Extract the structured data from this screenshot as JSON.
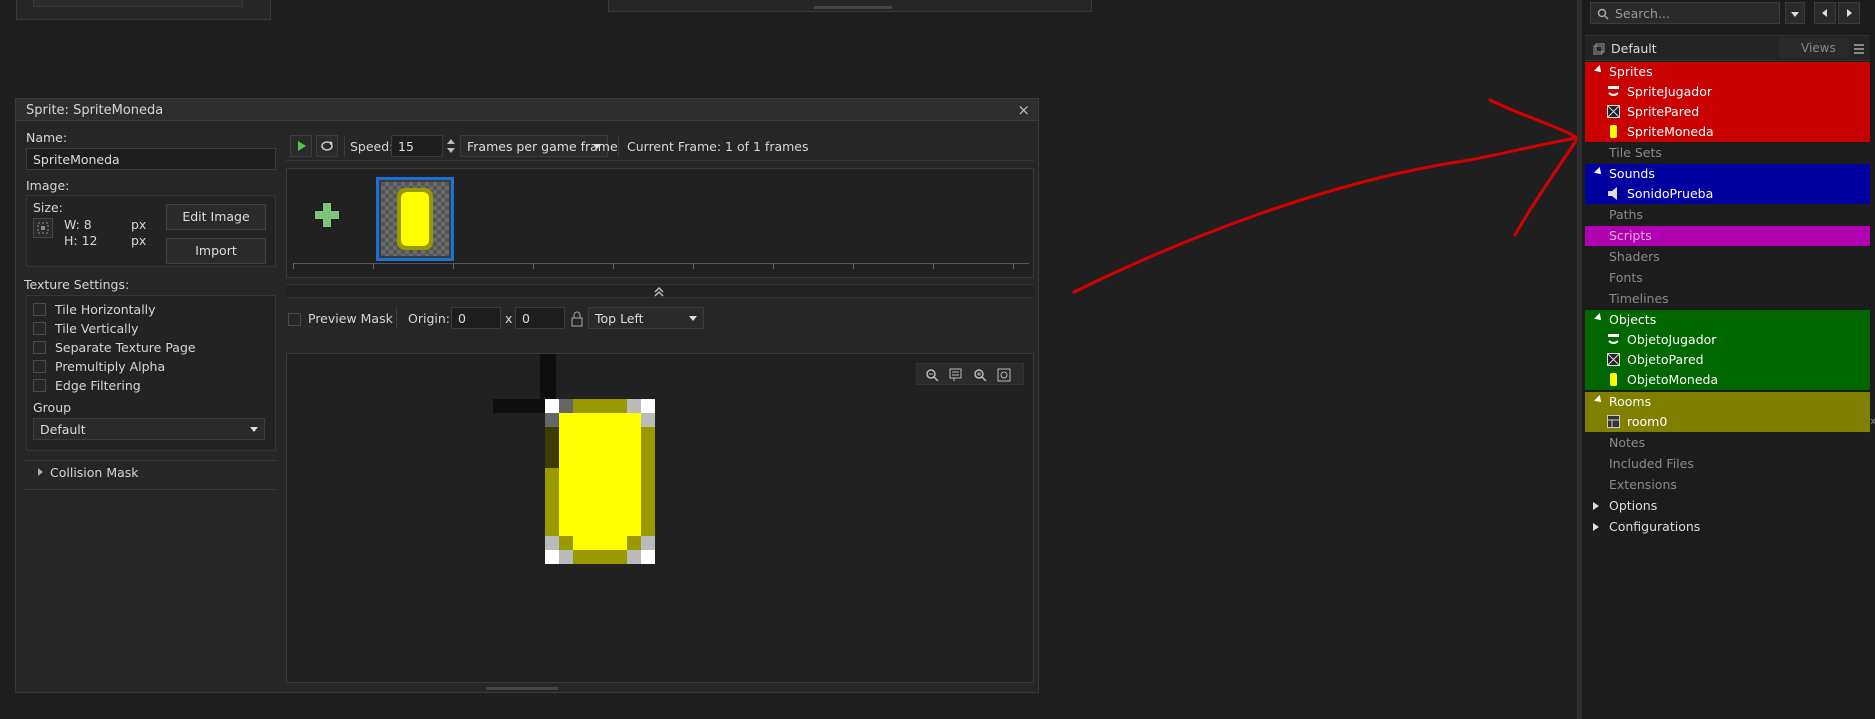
{
  "colors": {
    "sprites": "#c80000",
    "sounds": "#0000a0",
    "scripts": "#b000b0",
    "objects": "#006600",
    "rooms": "#7f7f00",
    "arrow": "#d40000",
    "coin": "#ffff00",
    "coin_dark": "#9a9a00",
    "selected_frame": "#1c6fd6"
  },
  "sprite_editor": {
    "title": "Sprite: SpriteMoneda",
    "close_glyph": "×",
    "name_label": "Name:",
    "name_value": "SpriteMoneda",
    "image_label": "Image:",
    "size_label": "Size:",
    "width": "W: 8",
    "height": "H: 12",
    "px": "px",
    "edit_image": "Edit Image",
    "import": "Import",
    "texture_settings_label": "Texture Settings:",
    "texture_options": [
      "Tile Horizontally",
      "Tile Vertically",
      "Separate Texture Page",
      "Premultiply Alpha",
      "Edge Filtering"
    ],
    "group_label": "Group",
    "group_value": "Default",
    "collision_mask": "Collision Mask",
    "speed_label": "Speed:",
    "speed_value": "15",
    "speed_unit": "Frames per game frame",
    "current_frame": "Current Frame: 1 of 1 frames",
    "preview_mask": "Preview Mask",
    "origin_label": "Origin:",
    "origin_x": "0",
    "origin_sep": "x",
    "origin_y": "0",
    "origin_preset": "Top Left"
  },
  "resource_tree": {
    "search_placeholder": "Search...",
    "view_name": "Default",
    "views_label": "Views",
    "sprites": {
      "label": "Sprites",
      "items": [
        "SpriteJugador",
        "SpritePared",
        "SpriteMoneda"
      ]
    },
    "tile_sets": "Tile Sets",
    "sounds": {
      "label": "Sounds",
      "items": [
        "SonidoPrueba"
      ]
    },
    "paths": "Paths",
    "scripts": "Scripts",
    "shaders": "Shaders",
    "fonts": "Fonts",
    "timelines": "Timelines",
    "objects": {
      "label": "Objects",
      "items": [
        "ObjetoJugador",
        "ObjetoPared",
        "ObjetoMoneda"
      ]
    },
    "rooms": {
      "label": "Rooms",
      "items": [
        "room0"
      ]
    },
    "notes": "Notes",
    "included_files": "Included Files",
    "extensions": "Extensions",
    "options": "Options",
    "configurations": "Configurations",
    "collapse_glyph": "»"
  }
}
